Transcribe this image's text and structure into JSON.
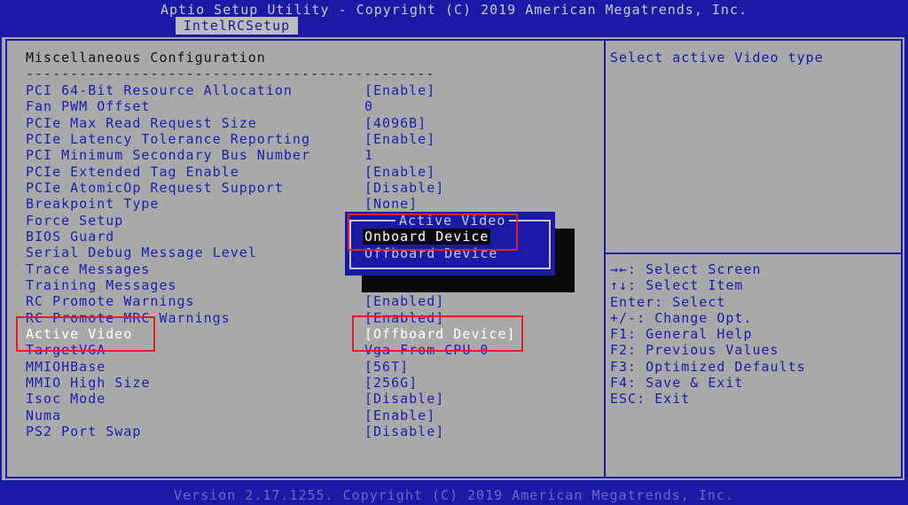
{
  "header": {
    "title": "Aptio Setup Utility - Copyright (C) 2019 American Megatrends, Inc.",
    "tab": "IntelRCSetup"
  },
  "section": {
    "title": "Miscellaneous Configuration",
    "separator": "----------------------------------------------"
  },
  "rows": [
    {
      "label": "PCI 64-Bit Resource Allocation",
      "value": "[Enable]"
    },
    {
      "label": "Fan PWM Offset",
      "value": "0"
    },
    {
      "label": "PCIe Max Read Request Size",
      "value": "[4096B]"
    },
    {
      "label": "PCIe Latency Tolerance Reporting",
      "value": "[Enable]"
    },
    {
      "label": "PCI Minimum Secondary Bus Number",
      "value": "1"
    },
    {
      "label": "PCIe Extended Tag Enable",
      "value": "[Enable]"
    },
    {
      "label": "PCIe AtomicOp Request Support",
      "value": "[Disable]"
    },
    {
      "label": "Breakpoint Type",
      "value": "[None]"
    },
    {
      "label": "Force Setup",
      "value": ""
    },
    {
      "label": "BIOS Guard",
      "value": ""
    },
    {
      "label": "Serial Debug Message Level",
      "value": ""
    },
    {
      "label": "Trace Messages",
      "value": ""
    },
    {
      "label": "Training Messages",
      "value": ""
    },
    {
      "label": "RC Promote Warnings",
      "value": "[Enabled]"
    },
    {
      "label": "RC Promote MRC Warnings",
      "value": "[Enabled]"
    },
    {
      "label": "Active Video",
      "value": "[Offboard Device]"
    },
    {
      "label": "TargetVGA",
      "value": "Vga From CPU 0"
    },
    {
      "label": "MMIOHBase",
      "value": "[56T]"
    },
    {
      "label": "MMIO High Size",
      "value": "[256G]"
    },
    {
      "label": "Isoc Mode",
      "value": "[Disable]"
    },
    {
      "label": "Numa",
      "value": "[Enable]"
    },
    {
      "label": "PS2 Port Swap",
      "value": "[Disable]"
    }
  ],
  "help_text": "Select active Video type",
  "keys": [
    "→←: Select Screen",
    "↑↓: Select Item",
    "Enter: Select",
    "+/-: Change Opt.",
    "F1: General Help",
    "F2: Previous Values",
    "F3: Optimized Defaults",
    "F4: Save & Exit",
    "ESC: Exit"
  ],
  "popup": {
    "title": "Active Video",
    "options": [
      "Onboard Device",
      "Offboard Device"
    ],
    "selected_option": "Onboard Device"
  },
  "footer": "Version 2.17.1255. Copyright (C) 2019 American Megatrends, Inc.",
  "colors": {
    "background": "#1a1aa6",
    "panel": "#a9a9a9",
    "item_text": "#1d1db0",
    "highlight_box": "#e02020"
  }
}
